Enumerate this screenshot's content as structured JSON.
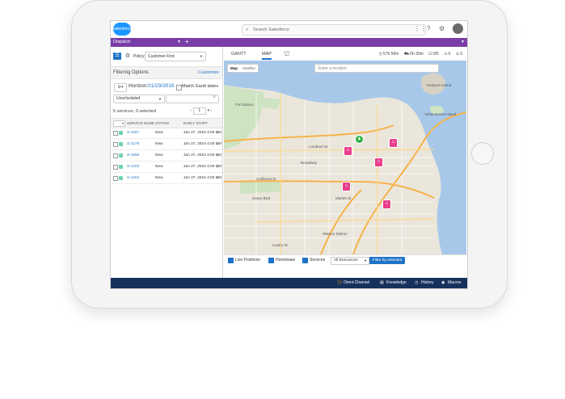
{
  "top_bar": {
    "logo_text": "salesforce",
    "search_placeholder": "Search Salesforce",
    "icons": [
      "grid-icon",
      "help-icon",
      "gear-icon",
      "avatar"
    ]
  },
  "nav": {
    "app_name": "Dispatch",
    "add_symbol": "+"
  },
  "left_panel": {
    "policy_label": "Policy:",
    "policy_value": "Customer First",
    "filter_title": "Filtering Options",
    "customize_link": "Customize",
    "horizon_label": "Horizon:",
    "horizon_date": "01/29/2016",
    "match_gantt_label": "Match Gantt dates",
    "status_filter": "Unscheduled",
    "count_text": "5 services, 0 selected",
    "page_number": "1",
    "columns": [
      "SERVICE NAME",
      "STATUS",
      "EARLY START"
    ],
    "rows": [
      {
        "id": "S-1167",
        "status": "New",
        "early_start": "Jan 27, 2016 4:00 PM"
      },
      {
        "id": "S-1178",
        "status": "New",
        "early_start": "Jan 27, 2016 4:00 PM"
      },
      {
        "id": "S-1094",
        "status": "New",
        "early_start": "Jan 27, 2016 4:00 PM"
      },
      {
        "id": "S-1103",
        "status": "New",
        "early_start": "Jan 27, 2016 4:00 PM"
      },
      {
        "id": "S-1104",
        "status": "New",
        "early_start": "Jan 27, 2016 4:00 PM"
      }
    ]
  },
  "right_panel": {
    "tabs": [
      "GANTT",
      "MAP"
    ],
    "active_tab": "MAP",
    "stats": [
      "57h 50m",
      "0h 30m",
      "0/5",
      "0",
      "0"
    ],
    "map_toggle": [
      "Map",
      "Satellite"
    ],
    "location_placeholder": "Enter a location",
    "map_labels": {
      "fort_mason": "Fort Mason",
      "lombard": "Lombard St",
      "broadway": "Broadway",
      "california": "California St",
      "geary": "Geary Blvd",
      "market": "Market St",
      "mission": "Mission District",
      "yerba": "Yerba Buena Island",
      "treasure": "Treasure Island",
      "castro": "Castro St"
    },
    "footer": {
      "live_positions": "Live Positions",
      "homebase": "Homebase",
      "services": "Services",
      "resources_select": "All Resources",
      "filter_button": "Filter by selected"
    }
  },
  "bottom_bar": {
    "items": [
      "Omni-Channel",
      "Knowledge",
      "History",
      "Macros"
    ]
  }
}
